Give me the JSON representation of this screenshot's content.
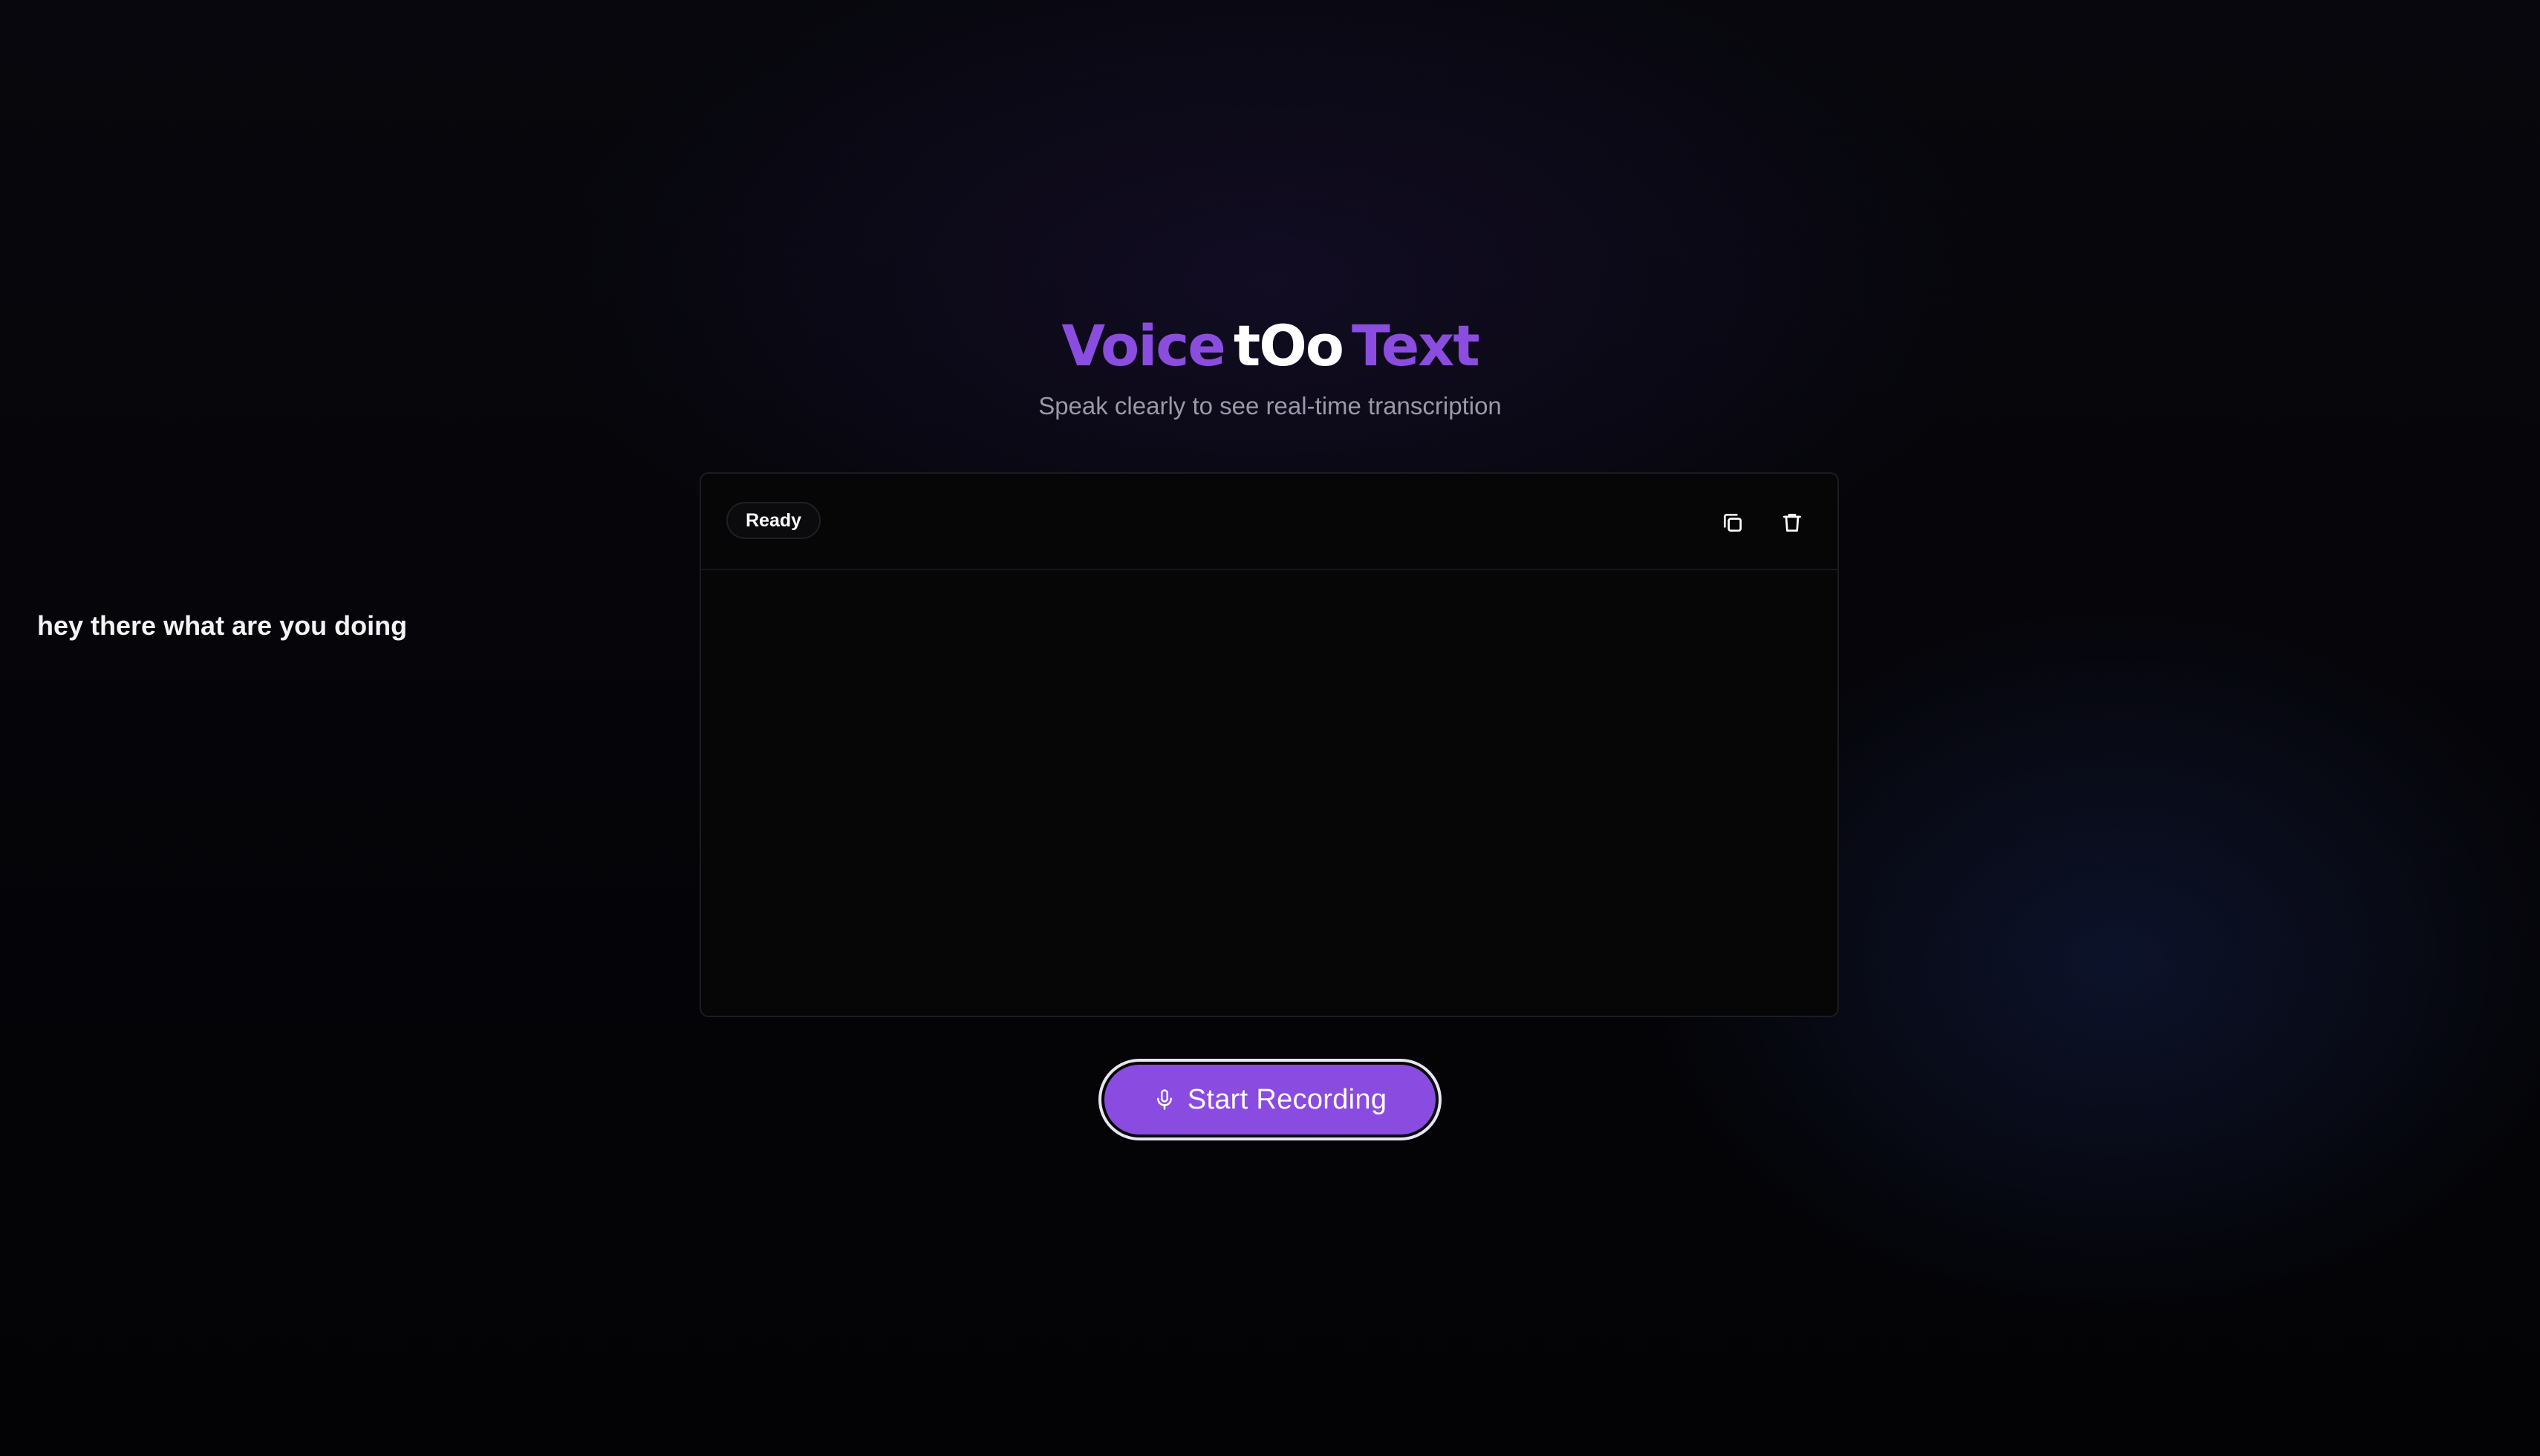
{
  "header": {
    "title_part1": "Voice",
    "title_part2": "tOo",
    "title_part3": "Text",
    "subtitle": "Speak clearly to see real-time transcription"
  },
  "card": {
    "status": "Ready",
    "transcript": "hey there what are you doing",
    "icons": {
      "copy": "copy-icon",
      "delete": "trash-icon"
    }
  },
  "controls": {
    "record_label": "Start Recording",
    "record_icon": "mic-icon"
  },
  "colors": {
    "accent": "#8a4be0",
    "background": "#050509",
    "card_background": "#060607",
    "subtitle_text": "#9a99a8"
  }
}
